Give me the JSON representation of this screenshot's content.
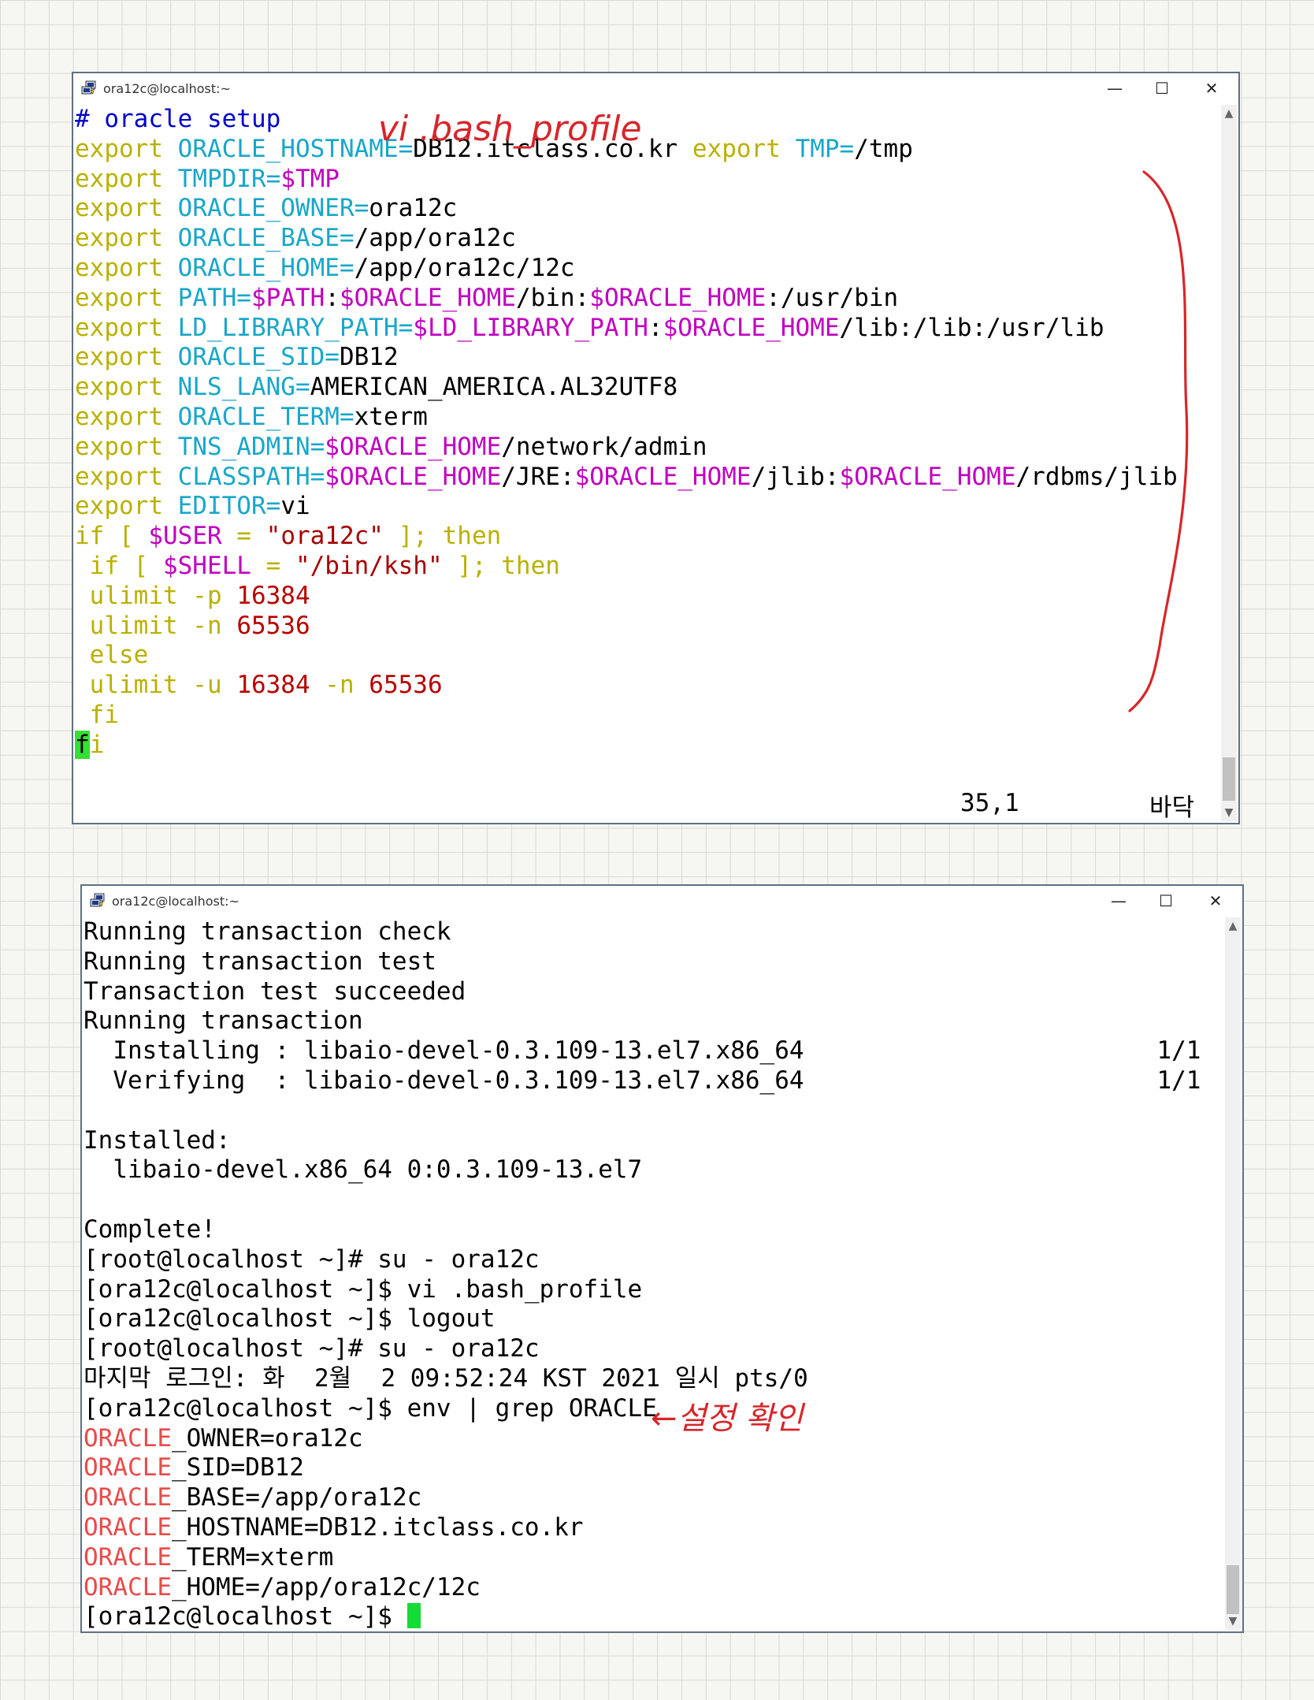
{
  "window1": {
    "title": "ora12c@localhost:~",
    "controls": {
      "minimize": "—",
      "maximize": "☐",
      "close": "✕"
    },
    "code": [
      [
        [
          "# oracle setup",
          "cmt"
        ]
      ],
      [
        [
          "export",
          "kw"
        ],
        [
          " ",
          ""
        ],
        [
          "ORACLE_HOSTNAME=",
          "var"
        ],
        [
          "DB12.itclass.co.kr",
          ""
        ],
        [
          " ",
          ""
        ],
        [
          "export",
          "kw"
        ],
        [
          " ",
          ""
        ],
        [
          "TMP=",
          "var"
        ],
        [
          "/tmp",
          ""
        ]
      ],
      [
        [
          "export",
          "kw"
        ],
        [
          " ",
          ""
        ],
        [
          "TMPDIR=",
          "var"
        ],
        [
          "$TMP",
          "ref"
        ]
      ],
      [
        [
          "export",
          "kw"
        ],
        [
          " ",
          ""
        ],
        [
          "ORACLE_OWNER=",
          "var"
        ],
        [
          "ora12c",
          ""
        ]
      ],
      [
        [
          "export",
          "kw"
        ],
        [
          " ",
          ""
        ],
        [
          "ORACLE_BASE=",
          "var"
        ],
        [
          "/app/ora12c",
          ""
        ]
      ],
      [
        [
          "export",
          "kw"
        ],
        [
          " ",
          ""
        ],
        [
          "ORACLE_HOME=",
          "var"
        ],
        [
          "/app/ora12c/12c",
          ""
        ]
      ],
      [
        [
          "export",
          "kw"
        ],
        [
          " ",
          ""
        ],
        [
          "PATH=",
          "var"
        ],
        [
          "$PATH",
          "ref"
        ],
        [
          ":",
          ""
        ],
        [
          "$ORACLE_HOME",
          "ref"
        ],
        [
          "/bin:",
          ""
        ],
        [
          "$ORACLE_HOME",
          "ref"
        ],
        [
          ":/usr/bin",
          ""
        ]
      ],
      [
        [
          "export",
          "kw"
        ],
        [
          " ",
          ""
        ],
        [
          "LD_LIBRARY_PATH=",
          "var"
        ],
        [
          "$LD_LIBRARY_PATH",
          "ref"
        ],
        [
          ":",
          ""
        ],
        [
          "$ORACLE_HOME",
          "ref"
        ],
        [
          "/lib:/lib:/usr/lib",
          ""
        ]
      ],
      [
        [
          "export",
          "kw"
        ],
        [
          " ",
          ""
        ],
        [
          "ORACLE_SID=",
          "var"
        ],
        [
          "DB12",
          ""
        ]
      ],
      [
        [
          "export",
          "kw"
        ],
        [
          " ",
          ""
        ],
        [
          "NLS_LANG=",
          "var"
        ],
        [
          "AMERICAN_AMERICA.AL32UTF8",
          ""
        ]
      ],
      [
        [
          "export",
          "kw"
        ],
        [
          " ",
          ""
        ],
        [
          "ORACLE_TERM=",
          "var"
        ],
        [
          "xterm",
          ""
        ]
      ],
      [
        [
          "export",
          "kw"
        ],
        [
          " ",
          ""
        ],
        [
          "TNS_ADMIN=",
          "var"
        ],
        [
          "$ORACLE_HOME",
          "ref"
        ],
        [
          "/network/admin",
          ""
        ]
      ],
      [
        [
          "export",
          "kw"
        ],
        [
          " ",
          ""
        ],
        [
          "CLASSPATH=",
          "var"
        ],
        [
          "$ORACLE_HOME",
          "ref"
        ],
        [
          "/JRE:",
          ""
        ],
        [
          "$ORACLE_HOME",
          "ref"
        ],
        [
          "/jlib:",
          ""
        ],
        [
          "$ORACLE_HOME",
          "ref"
        ],
        [
          "/rdbms/jlib",
          ""
        ]
      ],
      [
        [
          "export",
          "kw"
        ],
        [
          " ",
          ""
        ],
        [
          "EDITOR=",
          "var"
        ],
        [
          "vi",
          ""
        ]
      ],
      [
        [
          "if [ ",
          "kw"
        ],
        [
          "$USER",
          "ref"
        ],
        [
          " = ",
          "kw"
        ],
        [
          "\"ora12c\"",
          "str"
        ],
        [
          " ]; then",
          "kw"
        ]
      ],
      [
        [
          " if [ ",
          "kw"
        ],
        [
          "$SHELL",
          "ref"
        ],
        [
          " = ",
          "kw"
        ],
        [
          "\"/bin/ksh\"",
          "str"
        ],
        [
          " ]; then",
          "kw"
        ]
      ],
      [
        [
          " ulimit -p ",
          "kw"
        ],
        [
          "16384",
          "num"
        ]
      ],
      [
        [
          " ulimit -n ",
          "kw"
        ],
        [
          "65536",
          "num"
        ]
      ],
      [
        [
          " else",
          "kw"
        ]
      ],
      [
        [
          " ulimit -u ",
          "kw"
        ],
        [
          "16384",
          "num"
        ],
        [
          " -n ",
          "kw"
        ],
        [
          "65536",
          "num"
        ]
      ],
      [
        [
          " fi",
          "kw"
        ]
      ],
      [
        [
          "f",
          "cur1"
        ],
        [
          "i",
          "kw"
        ]
      ]
    ],
    "status": {
      "position": "35,1",
      "location": "바닥"
    }
  },
  "window2": {
    "title": "ora12c@localhost:~",
    "controls": {
      "minimize": "—",
      "maximize": "☐",
      "close": "✕"
    },
    "code": [
      [
        [
          "Running transaction check",
          ""
        ]
      ],
      [
        [
          "Running transaction test",
          ""
        ]
      ],
      [
        [
          "Transaction test succeeded",
          ""
        ]
      ],
      [
        [
          "Running transaction",
          ""
        ]
      ],
      [
        [
          "  Installing : libaio-devel-0.3.109-13.el7.x86_64                        1/1",
          ""
        ]
      ],
      [
        [
          "  Verifying  : libaio-devel-0.3.109-13.el7.x86_64                        1/1",
          ""
        ]
      ],
      [
        [
          "",
          ""
        ]
      ],
      [
        [
          "Installed:",
          ""
        ]
      ],
      [
        [
          "  libaio-devel.x86_64 0:0.3.109-13.el7",
          ""
        ]
      ],
      [
        [
          "",
          ""
        ]
      ],
      [
        [
          "Complete!",
          ""
        ]
      ],
      [
        [
          "[root@localhost ~]# su - ora12c",
          ""
        ]
      ],
      [
        [
          "[ora12c@localhost ~]$ vi .bash_profile",
          ""
        ]
      ],
      [
        [
          "[ora12c@localhost ~]$ logout",
          ""
        ]
      ],
      [
        [
          "[root@localhost ~]# su - ora12c",
          ""
        ]
      ],
      [
        [
          "마지막 로그인: 화  2월  2 09:52:24 KST 2021 일시 pts/0",
          ""
        ]
      ],
      [
        [
          "[ora12c@localhost ~]$ env | grep ORACLE",
          ""
        ]
      ],
      [
        [
          "ORACLE",
          "hl"
        ],
        [
          "_OWNER=ora12c",
          ""
        ]
      ],
      [
        [
          "ORACLE",
          "hl"
        ],
        [
          "_SID=DB12",
          ""
        ]
      ],
      [
        [
          "ORACLE",
          "hl"
        ],
        [
          "_BASE=/app/ora12c",
          ""
        ]
      ],
      [
        [
          "ORACLE",
          "hl"
        ],
        [
          "_HOSTNAME=DB12.itclass.co.kr",
          ""
        ]
      ],
      [
        [
          "ORACLE",
          "hl"
        ],
        [
          "_TERM=xterm",
          ""
        ]
      ],
      [
        [
          "ORACLE",
          "hl"
        ],
        [
          "_HOME=/app/ora12c/12c",
          ""
        ]
      ],
      [
        [
          "[ora12c@localhost ~]$ ",
          ""
        ],
        [
          "",
          "cur2"
        ]
      ]
    ]
  },
  "annotations": {
    "top_note": "vi .bash_profile",
    "bottom_note": "←설정 확인",
    "color": "#d7262b"
  }
}
